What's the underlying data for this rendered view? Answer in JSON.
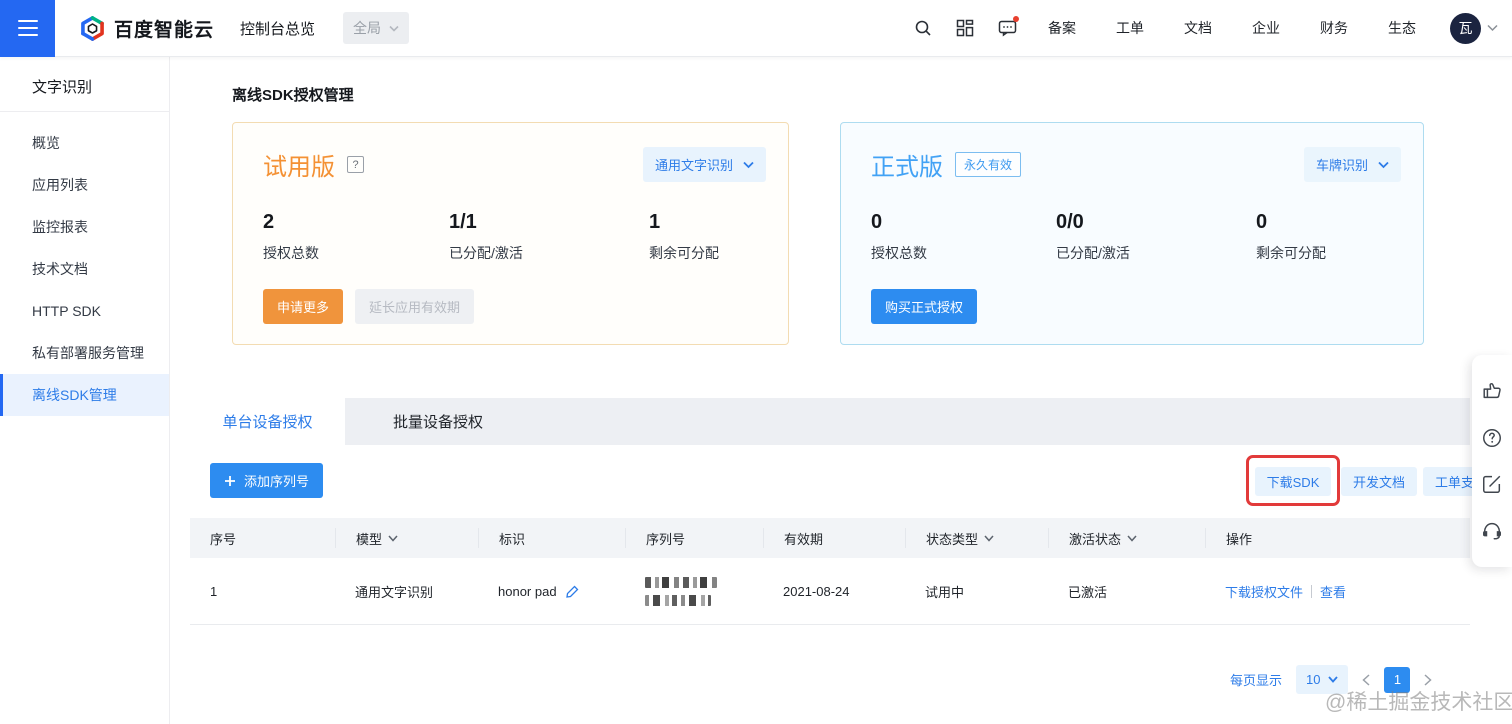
{
  "nav": {
    "brand": "百度智能云",
    "console_overview": "控制台总览",
    "region_selector": "全局",
    "menu_items": [
      "备案",
      "工单",
      "文档",
      "企业",
      "财务",
      "生态"
    ],
    "avatar_text": "瓦"
  },
  "sidebar": {
    "title": "文字识别",
    "items": [
      {
        "label": "概览",
        "active": false
      },
      {
        "label": "应用列表",
        "active": false
      },
      {
        "label": "监控报表",
        "active": false
      },
      {
        "label": "技术文档",
        "active": false
      },
      {
        "label": "HTTP SDK",
        "active": false
      },
      {
        "label": "私有部署服务管理",
        "active": false
      },
      {
        "label": "离线SDK管理",
        "active": true
      }
    ]
  },
  "page": {
    "title": "离线SDK授权管理"
  },
  "trial_card": {
    "title": "试用版",
    "selector": "通用文字识别",
    "stats": [
      {
        "value": "2",
        "label": "授权总数"
      },
      {
        "value": "1/1",
        "label": "已分配/激活"
      },
      {
        "value": "1",
        "label": "剩余可分配"
      }
    ],
    "primary_button": "申请更多",
    "secondary_button": "延长应用有效期"
  },
  "official_card": {
    "title": "正式版",
    "badge": "永久有效",
    "selector": "车牌识别",
    "stats": [
      {
        "value": "0",
        "label": "授权总数"
      },
      {
        "value": "0/0",
        "label": "已分配/激活"
      },
      {
        "value": "0",
        "label": "剩余可分配"
      }
    ],
    "primary_button": "购买正式授权"
  },
  "tabs": [
    {
      "label": "单台设备授权",
      "active": true
    },
    {
      "label": "批量设备授权",
      "active": false
    }
  ],
  "toolbar": {
    "add_serial": "添加序列号",
    "download_sdk": "下载SDK",
    "dev_docs": "开发文档",
    "ticket_support": "工单支持"
  },
  "table": {
    "headers": [
      {
        "label": "序号"
      },
      {
        "label": "模型"
      },
      {
        "label": "标识"
      },
      {
        "label": "序列号"
      },
      {
        "label": "有效期"
      },
      {
        "label": "状态类型"
      },
      {
        "label": "激活状态"
      },
      {
        "label": "操作"
      }
    ],
    "rows": [
      {
        "index": "1",
        "model": "通用文字识别",
        "identifier": "honor pad",
        "validity": "2021-08-24",
        "status_type": "试用中",
        "activation_status": "已激活",
        "action_download": "下载授权文件",
        "action_view": "查看"
      }
    ]
  },
  "pagination": {
    "per_page_label": "每页显示",
    "per_page_value": "10",
    "current_page": "1"
  },
  "watermark": "@稀土掘金技术社区",
  "colors": {
    "primary_blue": "#2468f2",
    "link_blue": "#2d7ce8",
    "button_blue": "#2d8cf0",
    "orange": "#f49134",
    "annotation_red": "#e23a3a"
  }
}
